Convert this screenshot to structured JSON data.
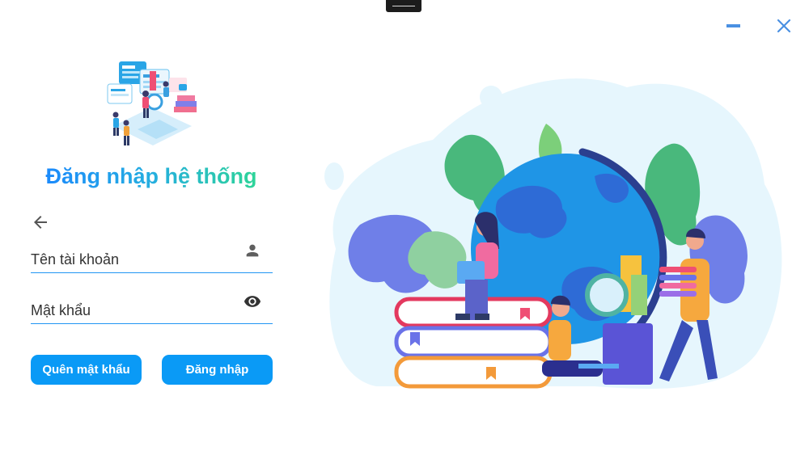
{
  "window": {
    "minimize_icon": "minimize-icon",
    "close_icon": "close-icon"
  },
  "login": {
    "title": "Đăng nhập hệ thống",
    "back_icon": "arrow-left-icon",
    "username": {
      "placeholder": "Tên tài khoản",
      "value": "",
      "icon": "user-icon"
    },
    "password": {
      "placeholder": "Mật khẩu",
      "value": "",
      "icon": "eye-icon"
    },
    "forgot_label": "Quên mật khẩu",
    "login_label": "Đăng nhập"
  },
  "colors": {
    "accent": "#0a9af6",
    "title_gradient_start": "#1a86ff",
    "title_gradient_end": "#2fd98f",
    "window_control": "#4a90e2"
  }
}
